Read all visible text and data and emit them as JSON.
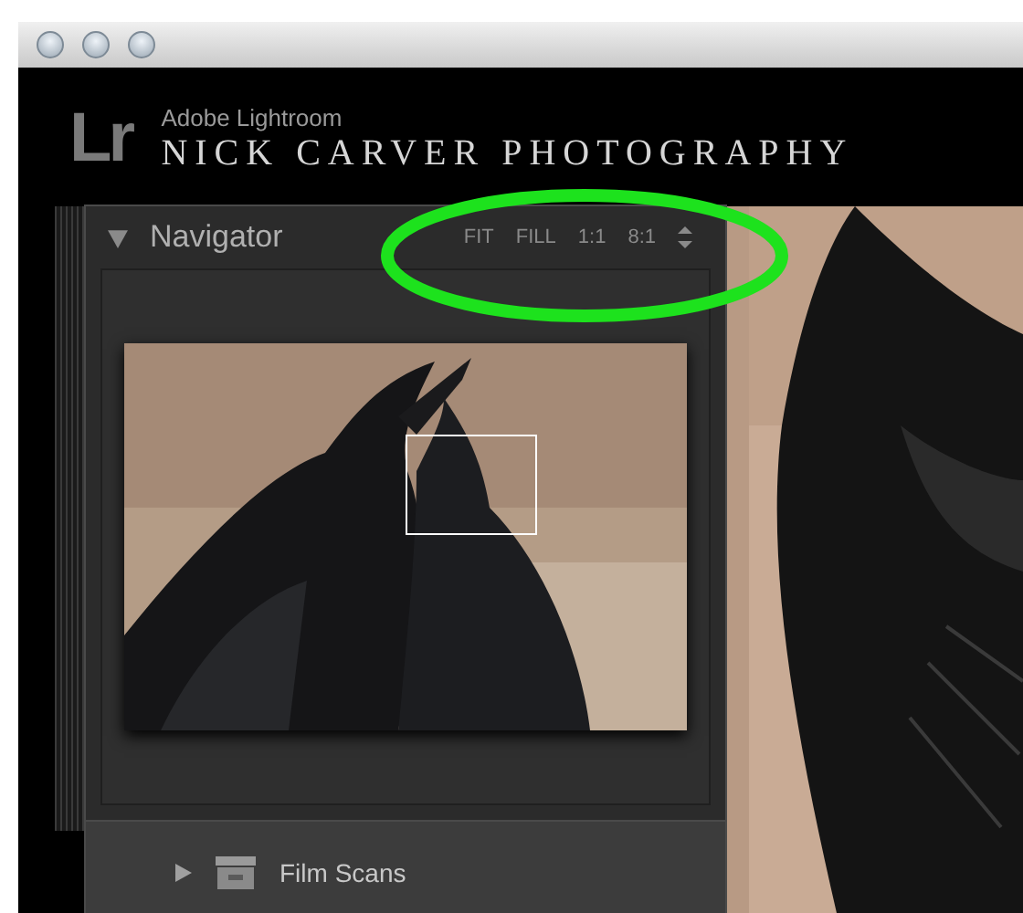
{
  "identity_plate": {
    "logo": "Lr",
    "app_name": "Adobe Lightroom",
    "studio_name": "NICK CARVER PHOTOGRAPHY"
  },
  "navigator": {
    "title": "Navigator",
    "expanded": true,
    "zoom_options": [
      {
        "label": "FIT",
        "selected": false
      },
      {
        "label": "FILL",
        "selected": false
      },
      {
        "label": "1:1",
        "selected": false
      },
      {
        "label": "8:1",
        "selected": false
      }
    ]
  },
  "collections": [
    {
      "name": "Film Scans",
      "expanded": false
    }
  ],
  "annotation": {
    "kind": "ellipse",
    "color": "#1de21d"
  }
}
